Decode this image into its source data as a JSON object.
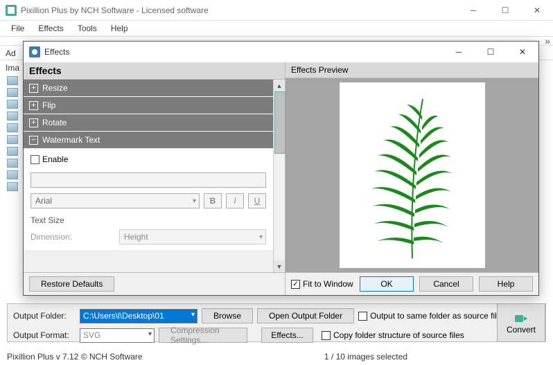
{
  "app": {
    "title": "Pixillion Plus by NCH Software - Licensed software",
    "menu": [
      "File",
      "Effects",
      "Tools",
      "Help"
    ],
    "add_label": "Ad",
    "images_label": "Ima"
  },
  "dialog": {
    "title": "Effects",
    "left_header": "Effects",
    "right_header": "Effects Preview",
    "items": {
      "resize": "Resize",
      "flip": "Flip",
      "rotate": "Rotate",
      "watermark": "Watermark Text"
    },
    "watermark": {
      "enable_label": "Enable",
      "font": "Arial",
      "bold": "B",
      "italic": "I",
      "underline": "U",
      "text_size_label": "Text Size",
      "dimension_label": "Dimension:",
      "dimension_value": "Height"
    },
    "restore": "Restore Defaults",
    "fit_label": "Fit to Window",
    "ok": "OK",
    "cancel": "Cancel",
    "help": "Help"
  },
  "bottom": {
    "output_folder_label": "Output Folder:",
    "output_folder_value": "C:\\Users\\l\\Desktop\\01",
    "browse": "Browse",
    "open_output": "Open Output Folder",
    "output_format_label": "Output Format:",
    "output_format_value": "SVG",
    "compression": "Compression Settings...",
    "effects_btn": "Effects...",
    "same_folder": "Output to same folder as source files",
    "copy_structure": "Copy folder structure of source files",
    "convert": "Convert"
  },
  "status": {
    "version": "Pixillion Plus v 7.12 © NCH Software",
    "selection": "1 / 10 images selected"
  }
}
